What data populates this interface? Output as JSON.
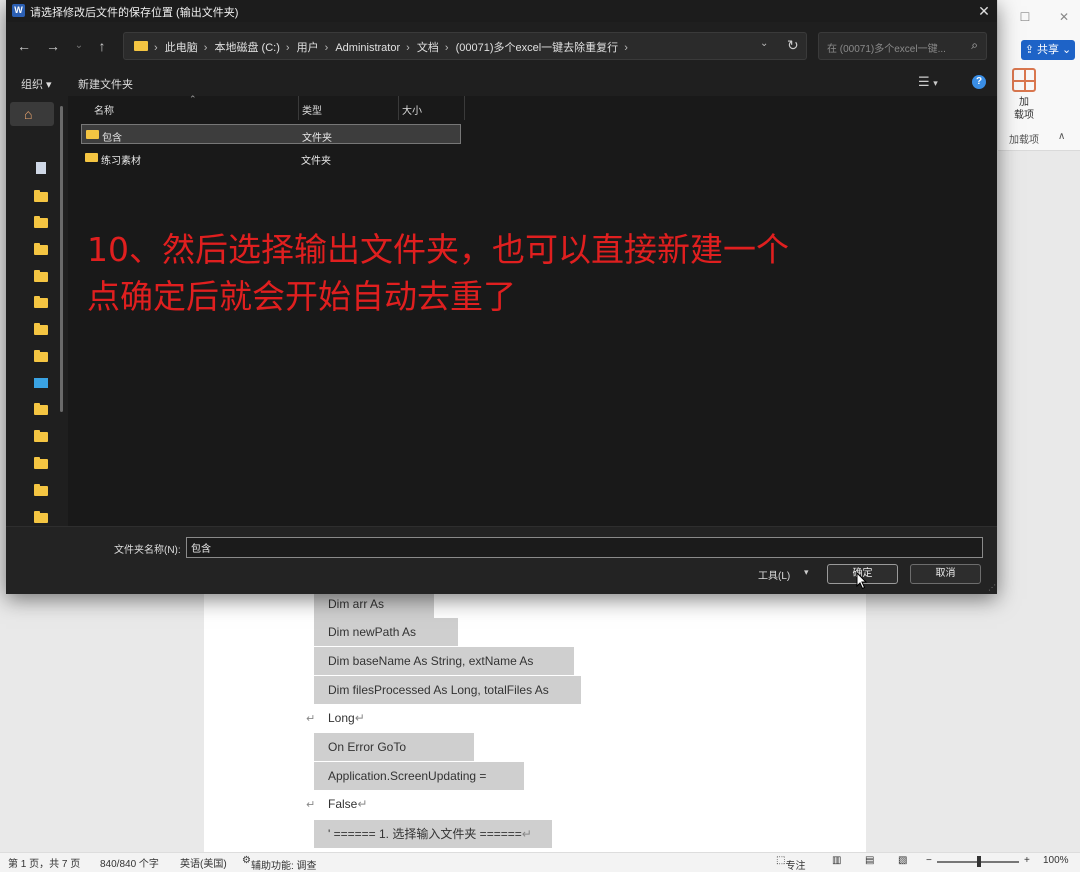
{
  "dialog": {
    "app_icon": "W",
    "title": "请选择修改后文件的保存位置 (输出文件夹)",
    "close_glyph": "✕",
    "breadcrumbs": [
      "此电脑",
      "本地磁盘 (C:)",
      "用户",
      "Administrator",
      "文档",
      "(00071)多个excel一键去除重复行"
    ],
    "search_placeholder": "在 (00071)多个excel一键...",
    "organize_label": "组织 ▾",
    "new_folder_label": "新建文件夹",
    "columns": {
      "name": "名称",
      "type": "类型",
      "size": "大小"
    },
    "rows": [
      {
        "name": "包含",
        "type": "文件夹"
      },
      {
        "name": "练习素材",
        "type": "文件夹"
      }
    ],
    "folder_name_label": "文件夹名称(N):",
    "folder_name_value": "包含",
    "tools_label": "工具(L)",
    "ok_label": "确定",
    "cancel_label": "取消"
  },
  "annotation": {
    "line1": "10、然后选择输出文件夹，也可以直接新建一个",
    "line2": "点确定后就会开始自动去重了",
    "color": "#e01f1f"
  },
  "word": {
    "share_label": "共享",
    "addin_label": "加\n载项",
    "addin_group": "加载项",
    "code_lines": [
      "Dim arr As Variant",
      "Dim newPath As String",
      "Dim baseName As String, extName As String",
      "Dim filesProcessed As Long, totalFiles As Long",
      "On Error GoTo ErrHandler",
      "Application.ScreenUpdating = False",
      "' ====== 1. 选择输入文件夹 ======"
    ],
    "para_mark": "↵"
  },
  "statusbar": {
    "page": "第 1 页，共 7 页",
    "words": "840/840 个字",
    "language": "英语(美国)",
    "accessibility": "辅助功能: 调查",
    "focus": "专注",
    "zoom": "100%"
  },
  "colors": {
    "dialog_bg": "#1f1f1f",
    "folder": "#f4c542",
    "share": "#1e63c7"
  }
}
